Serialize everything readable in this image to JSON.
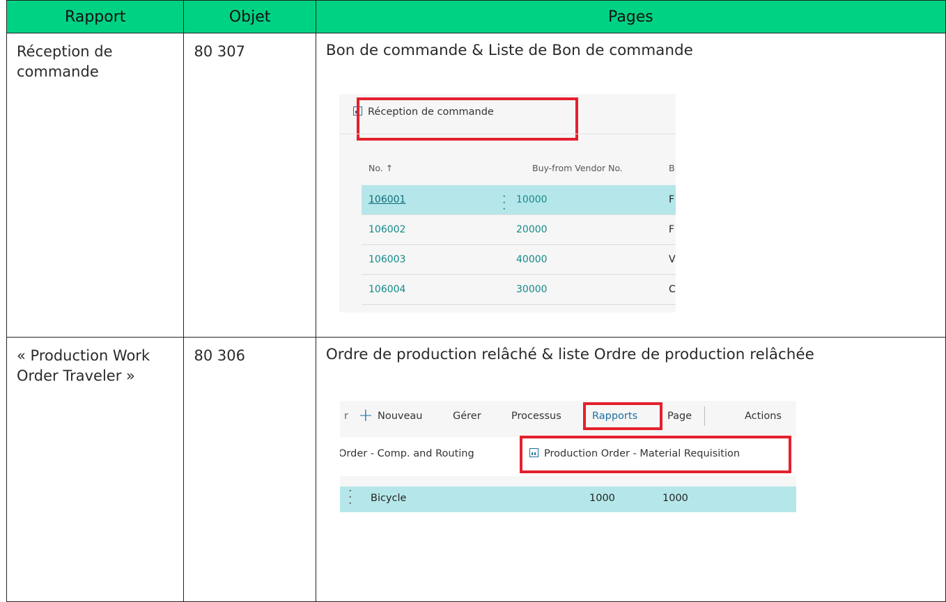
{
  "table": {
    "headers": [
      "Rapport",
      "Objet",
      "Pages"
    ],
    "rows": [
      {
        "rapport": "Réception de commande",
        "objet": "80 307",
        "pages_title": "Bon de commande & Liste de Bon de commande"
      },
      {
        "rapport": "« Production Work Order Traveler »",
        "objet": "80 306",
        "pages_title": "Ordre de production relâché & liste Ordre de production relâchée"
      }
    ]
  },
  "shot1": {
    "action_label": "Réception de commande",
    "columns": [
      "No. ↑",
      "Buy-from Vendor No.",
      "B"
    ],
    "rows": [
      {
        "no": "106001",
        "vendor": "10000",
        "c": "F",
        "selected": true
      },
      {
        "no": "106002",
        "vendor": "20000",
        "c": "F",
        "selected": false
      },
      {
        "no": "106003",
        "vendor": "40000",
        "c": "V",
        "selected": false
      },
      {
        "no": "106004",
        "vendor": "30000",
        "c": "C",
        "selected": false
      }
    ]
  },
  "shot2": {
    "menu": {
      "cut": "r",
      "nouveau": "Nouveau",
      "gerer": "Gérer",
      "processus": "Processus",
      "rapports": "Rapports",
      "page": "Page",
      "actions": "Actions"
    },
    "sub_left": "Order - Comp. and Routing",
    "sub_right": "Production Order - Material Requisition",
    "row": {
      "description": "Bicycle",
      "v1": "1000",
      "v2": "1000"
    }
  },
  "colors": {
    "header_green": "#00d283",
    "highlight_red": "#e5202d",
    "selected_row": "#b5e7ea",
    "link_teal": "#138a8a"
  }
}
